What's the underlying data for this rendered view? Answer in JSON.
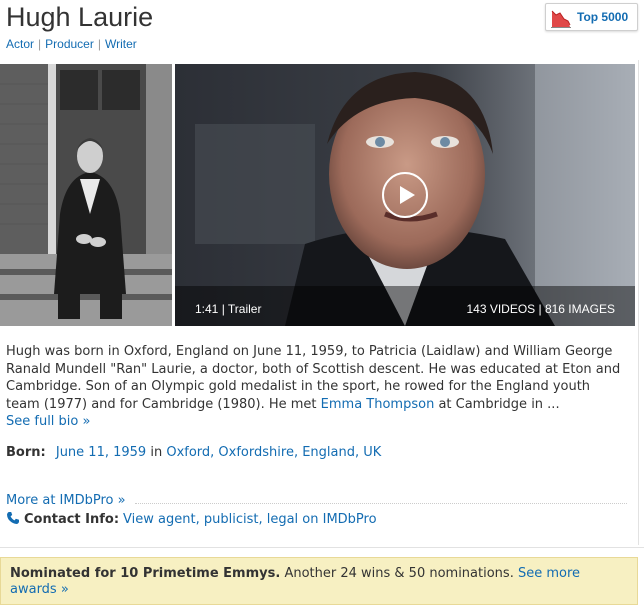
{
  "person": {
    "name": "Hugh Laurie",
    "roles": [
      "Actor",
      "Producer",
      "Writer"
    ]
  },
  "meter": {
    "label": "Top 5000",
    "icon": "starmeter-chart-icon"
  },
  "video": {
    "duration_type": "1:41 | Trailer",
    "counts": "143 VIDEOS | 816 IMAGES"
  },
  "bio": {
    "text_before": "Hugh was born in Oxford, England on June 11, 1959, to Patricia (Laidlaw) and William George Ranald Mundell \"Ran\" Laurie, a doctor, both of Scottish descent. He was educated at Eton and Cambridge. Son of an Olympic gold medalist in the sport, he rowed for the England youth team (1977) and for Cambridge (1980). He met ",
    "link_name": "Emma Thompson",
    "text_after": " at Cambridge in ...",
    "see_full": "See full bio »"
  },
  "born": {
    "label": "Born:",
    "date": "June 11, 1959",
    "in": "in",
    "place": "Oxford, Oxfordshire, England, UK"
  },
  "imdbpro": {
    "more": "More at IMDbPro »",
    "contact_label": "Contact Info:",
    "contact_link": "View agent, publicist, legal on IMDbPro"
  },
  "awards": {
    "bold": "Nominated for 10 Primetime Emmys.",
    "text": "Another 24 wins & 50 nominations.",
    "link": "See more awards »"
  },
  "colors": {
    "link": "#136cb2",
    "awards_bg": "#f7f0c2"
  }
}
